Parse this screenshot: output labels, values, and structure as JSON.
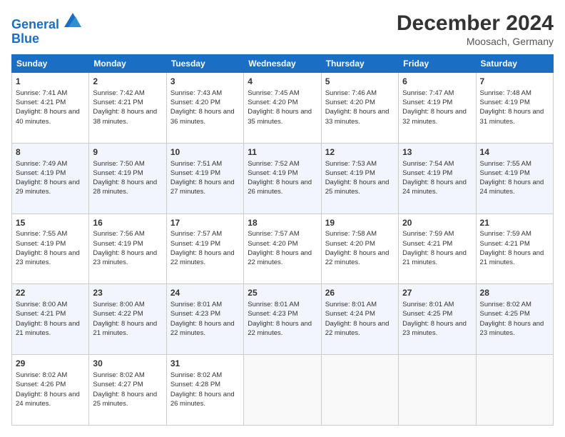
{
  "logo": {
    "line1": "General",
    "line2": "Blue"
  },
  "header": {
    "title": "December 2024",
    "location": "Moosach, Germany"
  },
  "weekdays": [
    "Sunday",
    "Monday",
    "Tuesday",
    "Wednesday",
    "Thursday",
    "Friday",
    "Saturday"
  ],
  "weeks": [
    [
      {
        "day": "1",
        "sunrise": "Sunrise: 7:41 AM",
        "sunset": "Sunset: 4:21 PM",
        "daylight": "Daylight: 8 hours and 40 minutes."
      },
      {
        "day": "2",
        "sunrise": "Sunrise: 7:42 AM",
        "sunset": "Sunset: 4:21 PM",
        "daylight": "Daylight: 8 hours and 38 minutes."
      },
      {
        "day": "3",
        "sunrise": "Sunrise: 7:43 AM",
        "sunset": "Sunset: 4:20 PM",
        "daylight": "Daylight: 8 hours and 36 minutes."
      },
      {
        "day": "4",
        "sunrise": "Sunrise: 7:45 AM",
        "sunset": "Sunset: 4:20 PM",
        "daylight": "Daylight: 8 hours and 35 minutes."
      },
      {
        "day": "5",
        "sunrise": "Sunrise: 7:46 AM",
        "sunset": "Sunset: 4:20 PM",
        "daylight": "Daylight: 8 hours and 33 minutes."
      },
      {
        "day": "6",
        "sunrise": "Sunrise: 7:47 AM",
        "sunset": "Sunset: 4:19 PM",
        "daylight": "Daylight: 8 hours and 32 minutes."
      },
      {
        "day": "7",
        "sunrise": "Sunrise: 7:48 AM",
        "sunset": "Sunset: 4:19 PM",
        "daylight": "Daylight: 8 hours and 31 minutes."
      }
    ],
    [
      {
        "day": "8",
        "sunrise": "Sunrise: 7:49 AM",
        "sunset": "Sunset: 4:19 PM",
        "daylight": "Daylight: 8 hours and 29 minutes."
      },
      {
        "day": "9",
        "sunrise": "Sunrise: 7:50 AM",
        "sunset": "Sunset: 4:19 PM",
        "daylight": "Daylight: 8 hours and 28 minutes."
      },
      {
        "day": "10",
        "sunrise": "Sunrise: 7:51 AM",
        "sunset": "Sunset: 4:19 PM",
        "daylight": "Daylight: 8 hours and 27 minutes."
      },
      {
        "day": "11",
        "sunrise": "Sunrise: 7:52 AM",
        "sunset": "Sunset: 4:19 PM",
        "daylight": "Daylight: 8 hours and 26 minutes."
      },
      {
        "day": "12",
        "sunrise": "Sunrise: 7:53 AM",
        "sunset": "Sunset: 4:19 PM",
        "daylight": "Daylight: 8 hours and 25 minutes."
      },
      {
        "day": "13",
        "sunrise": "Sunrise: 7:54 AM",
        "sunset": "Sunset: 4:19 PM",
        "daylight": "Daylight: 8 hours and 24 minutes."
      },
      {
        "day": "14",
        "sunrise": "Sunrise: 7:55 AM",
        "sunset": "Sunset: 4:19 PM",
        "daylight": "Daylight: 8 hours and 24 minutes."
      }
    ],
    [
      {
        "day": "15",
        "sunrise": "Sunrise: 7:55 AM",
        "sunset": "Sunset: 4:19 PM",
        "daylight": "Daylight: 8 hours and 23 minutes."
      },
      {
        "day": "16",
        "sunrise": "Sunrise: 7:56 AM",
        "sunset": "Sunset: 4:19 PM",
        "daylight": "Daylight: 8 hours and 23 minutes."
      },
      {
        "day": "17",
        "sunrise": "Sunrise: 7:57 AM",
        "sunset": "Sunset: 4:19 PM",
        "daylight": "Daylight: 8 hours and 22 minutes."
      },
      {
        "day": "18",
        "sunrise": "Sunrise: 7:57 AM",
        "sunset": "Sunset: 4:20 PM",
        "daylight": "Daylight: 8 hours and 22 minutes."
      },
      {
        "day": "19",
        "sunrise": "Sunrise: 7:58 AM",
        "sunset": "Sunset: 4:20 PM",
        "daylight": "Daylight: 8 hours and 22 minutes."
      },
      {
        "day": "20",
        "sunrise": "Sunrise: 7:59 AM",
        "sunset": "Sunset: 4:21 PM",
        "daylight": "Daylight: 8 hours and 21 minutes."
      },
      {
        "day": "21",
        "sunrise": "Sunrise: 7:59 AM",
        "sunset": "Sunset: 4:21 PM",
        "daylight": "Daylight: 8 hours and 21 minutes."
      }
    ],
    [
      {
        "day": "22",
        "sunrise": "Sunrise: 8:00 AM",
        "sunset": "Sunset: 4:21 PM",
        "daylight": "Daylight: 8 hours and 21 minutes."
      },
      {
        "day": "23",
        "sunrise": "Sunrise: 8:00 AM",
        "sunset": "Sunset: 4:22 PM",
        "daylight": "Daylight: 8 hours and 21 minutes."
      },
      {
        "day": "24",
        "sunrise": "Sunrise: 8:01 AM",
        "sunset": "Sunset: 4:23 PM",
        "daylight": "Daylight: 8 hours and 22 minutes."
      },
      {
        "day": "25",
        "sunrise": "Sunrise: 8:01 AM",
        "sunset": "Sunset: 4:23 PM",
        "daylight": "Daylight: 8 hours and 22 minutes."
      },
      {
        "day": "26",
        "sunrise": "Sunrise: 8:01 AM",
        "sunset": "Sunset: 4:24 PM",
        "daylight": "Daylight: 8 hours and 22 minutes."
      },
      {
        "day": "27",
        "sunrise": "Sunrise: 8:01 AM",
        "sunset": "Sunset: 4:25 PM",
        "daylight": "Daylight: 8 hours and 23 minutes."
      },
      {
        "day": "28",
        "sunrise": "Sunrise: 8:02 AM",
        "sunset": "Sunset: 4:25 PM",
        "daylight": "Daylight: 8 hours and 23 minutes."
      }
    ],
    [
      {
        "day": "29",
        "sunrise": "Sunrise: 8:02 AM",
        "sunset": "Sunset: 4:26 PM",
        "daylight": "Daylight: 8 hours and 24 minutes."
      },
      {
        "day": "30",
        "sunrise": "Sunrise: 8:02 AM",
        "sunset": "Sunset: 4:27 PM",
        "daylight": "Daylight: 8 hours and 25 minutes."
      },
      {
        "day": "31",
        "sunrise": "Sunrise: 8:02 AM",
        "sunset": "Sunset: 4:28 PM",
        "daylight": "Daylight: 8 hours and 26 minutes."
      },
      null,
      null,
      null,
      null
    ]
  ]
}
